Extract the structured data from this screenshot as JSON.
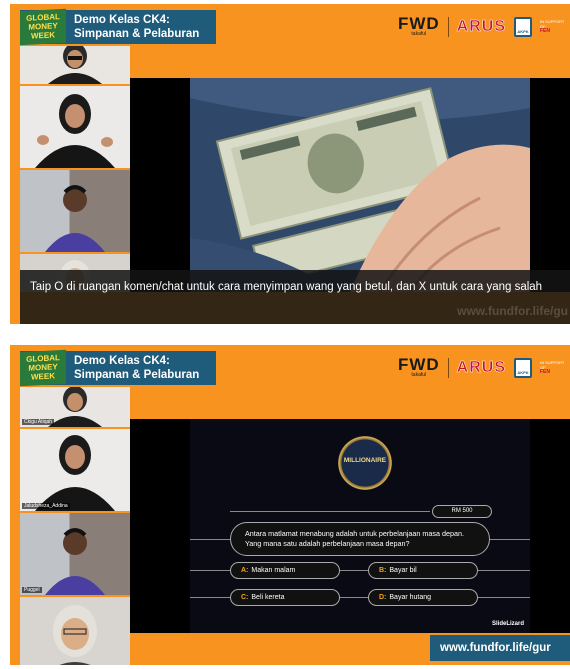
{
  "colors": {
    "banner": "#f7931e",
    "brand_bg": "#1f5b7a",
    "caption_bg": "#141414"
  },
  "brand": {
    "logo_text": "GLOBAL MONEY WEEK",
    "title_line1": "Demo Kelas CK4:",
    "title_line2": "Simpanan & Pelaburan"
  },
  "logos": {
    "fwd": "FWD",
    "fwd_sub": "takaful",
    "arus": "ARUS",
    "badge": "AKPK",
    "support": "IN SUPPORT OF",
    "support_org": "FEN"
  },
  "screen1": {
    "caption": "Taip O di ruangan komen/chat untuk cara menyimpan wang yang betul, dan X untuk cara yang salah",
    "watermark_url": "www.fundfor.life/gu"
  },
  "screen2": {
    "participants": [
      "Ckigu Atiqah",
      "Jaludsheza_Addina",
      "Puggel",
      "tjcoesh"
    ],
    "quiz": {
      "logo": "MILLIONAIRE",
      "prize": "RM 500",
      "question": "Antara matlamat menabung adalah untuk perbelanjaan masa depan. Yang mana satu adalah perbelanjaan masa depan?",
      "options": [
        {
          "letter": "A:",
          "text": "Makan malam"
        },
        {
          "letter": "B:",
          "text": "Bayar bil"
        },
        {
          "letter": "C:",
          "text": "Beli kereta"
        },
        {
          "letter": "D:",
          "text": "Bayar hutang"
        }
      ],
      "credit": "SlideLizard"
    },
    "url": "www.fundfor.life/gur"
  }
}
